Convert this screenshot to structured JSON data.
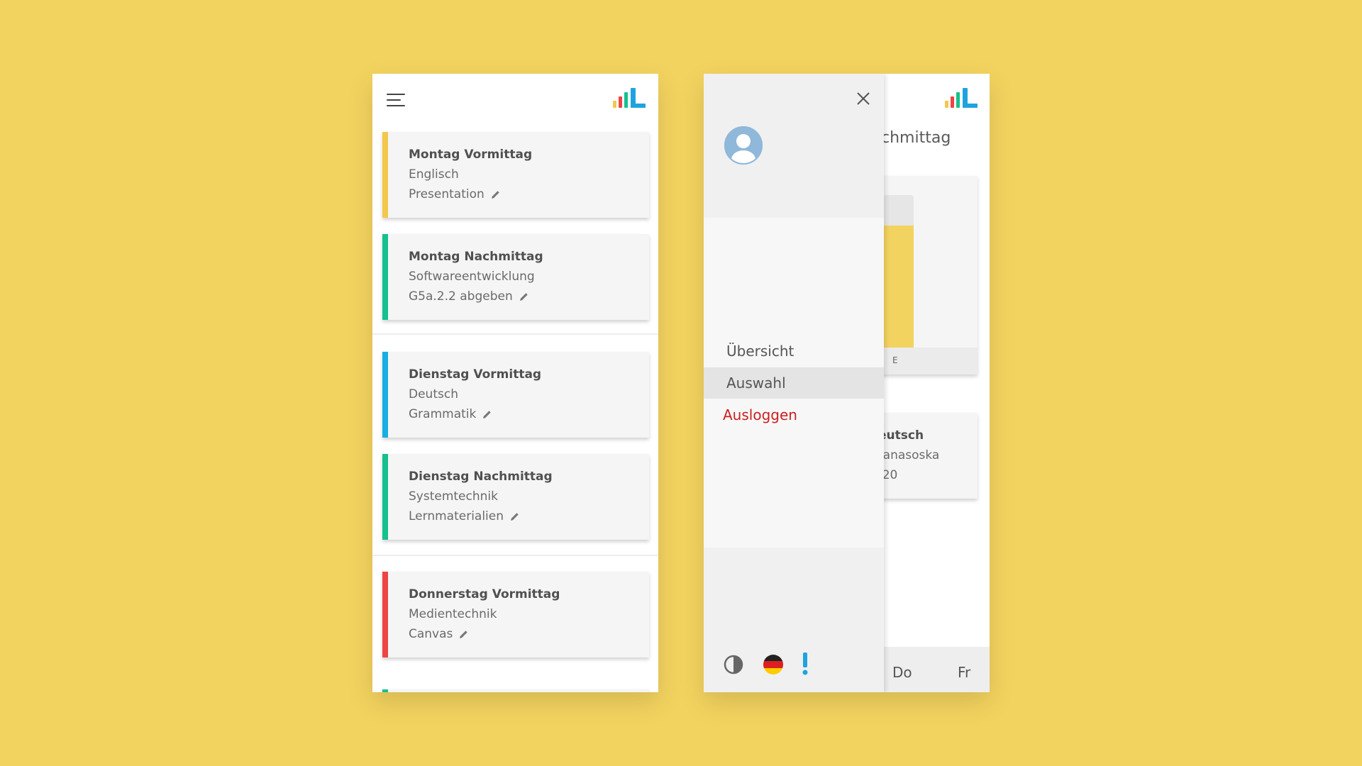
{
  "colors": {
    "background": "#F3D35F",
    "yellow": "#F3C84B",
    "green": "#16C08F",
    "blue": "#17AEE3",
    "red": "#EE4444",
    "logout_red": "#CC1F1F",
    "logo_blue": "#1FA3DF"
  },
  "icons": {
    "menu": "hamburger-icon",
    "logo": "bar-chart-logo",
    "edit": "pencil-icon",
    "close": "close-icon",
    "avatar": "user-avatar-icon",
    "contrast": "contrast-icon",
    "language": "german-flag-icon",
    "alert": "exclamation-icon"
  },
  "left_screen": {
    "cards": [
      {
        "title": "Montag Vormittag",
        "subject": "Englisch",
        "task": "Presentation",
        "color": "#F3C84B"
      },
      {
        "title": "Montag Nachmittag",
        "subject": "Softwareentwicklung",
        "task": "G5a.2.2 abgeben",
        "color": "#16C08F"
      },
      {
        "title": "Dienstag Vormittag",
        "subject": "Deutsch",
        "task": "Grammatik",
        "color": "#17AEE3"
      },
      {
        "title": "Dienstag Nachmittag",
        "subject": "Systemtechnik",
        "task": "Lernmaterialien",
        "color": "#16C08F"
      },
      {
        "title": "Donnerstag Vormittag",
        "subject": "Medientechnik",
        "task": "Canvas",
        "color": "#EE4444"
      }
    ]
  },
  "right_screen": {
    "page_title_partial": "chmittag",
    "chart": {
      "bar_fill_fraction": 0.8,
      "bar_label": "E",
      "bar_color": "#F3D35F"
    },
    "info_card": {
      "title_partial": "eutsch",
      "line2_partial": "tanasoska",
      "line3_partial": "/20"
    },
    "bottom_nav": {
      "day1": "Do",
      "day2": "Fr"
    },
    "drawer": {
      "menu": [
        {
          "label": "Übersicht",
          "active": false
        },
        {
          "label": "Auswahl",
          "active": true
        },
        {
          "label": "Ausloggen",
          "active": false
        }
      ]
    }
  }
}
